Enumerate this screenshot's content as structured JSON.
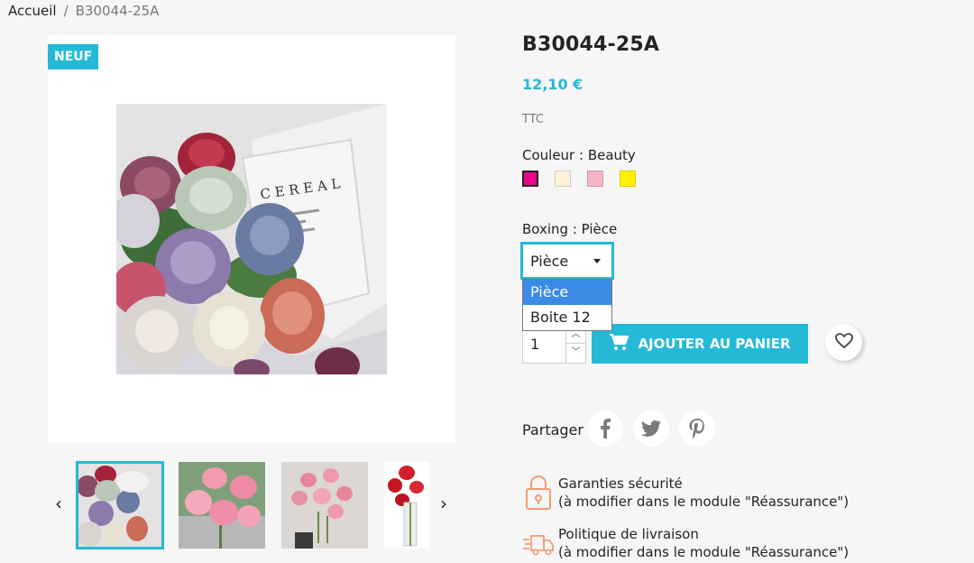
{
  "breadcrumb": {
    "home": "Accueil",
    "separator": "/",
    "current": "B30044-25A"
  },
  "gallery": {
    "badge": "NEUF",
    "main_image": "peony-bouquet-cereal-photo",
    "thumbnails": [
      "peony-bouquet",
      "pink-roses-bouquet",
      "pink-roses-vase",
      "red-roses-vase"
    ],
    "active_thumbnail_index": 0,
    "prev_icon": "chevron-left-icon",
    "next_icon": "chevron-right-icon"
  },
  "product": {
    "title": "B30044-25A",
    "price": "12,10 €",
    "tax_label": "TTC"
  },
  "variants": {
    "color_label": "Couleur : Beauty",
    "swatches": [
      {
        "color": "#e8048a",
        "selected": true
      },
      {
        "color": "#fdf3dc",
        "selected": false
      },
      {
        "color": "#f5b6c6",
        "selected": false
      },
      {
        "color": "#fff200",
        "selected": false
      }
    ],
    "boxing_label": "Boxing : Pièce",
    "boxing_value": "Pièce",
    "boxing_options": [
      "Pièce",
      "Boite 12"
    ],
    "highlighted_option_index": 0
  },
  "cart": {
    "quantity": "1",
    "add_label": "AJOUTER AU PANIER"
  },
  "share": {
    "label": "Partager",
    "networks": [
      "facebook-icon",
      "twitter-icon",
      "pinterest-icon"
    ]
  },
  "reassurance": [
    {
      "icon": "lock-icon",
      "title": "Garanties sécurité",
      "subtitle": "(à modifier dans le module \"Réassurance\")"
    },
    {
      "icon": "delivery-truck-icon",
      "title": "Politique de livraison",
      "subtitle": "(à modifier dans le module \"Réassurance\")"
    }
  ],
  "colors": {
    "accent": "#24b9d7",
    "text": "#232323",
    "muted": "#7a7a7a",
    "background": "#f6f6f6",
    "option_highlight": "#3b8ae6",
    "reassurance_icon": "#f39d72"
  }
}
